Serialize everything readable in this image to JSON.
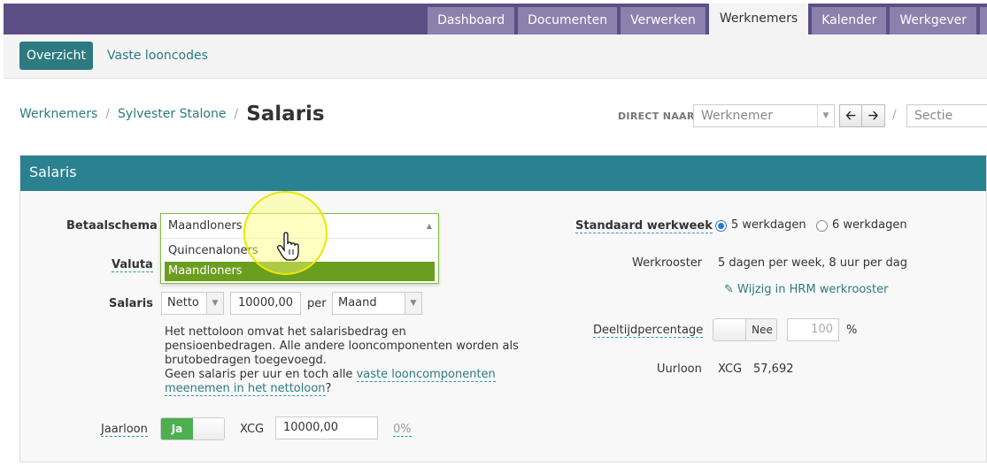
{
  "topnav": {
    "tabs": [
      "Dashboard",
      "Documenten",
      "Verwerken",
      "Werknemers",
      "Kalender",
      "Werkgever"
    ],
    "active": "Werknemers"
  },
  "subnav": {
    "primary": "Overzicht",
    "link": "Vaste looncodes"
  },
  "breadcrumb": {
    "item1": "Werknemers",
    "item2": "Sylvester Stalone",
    "sep": "/",
    "title": "Salaris"
  },
  "direct": {
    "label": "DIRECT NAAR",
    "werknemer_placeholder": "Werknemer",
    "sectie_placeholder": "Sectie",
    "slash": "/"
  },
  "panel": {
    "title": "Salaris"
  },
  "form": {
    "betaalschema_label": "Betaalschema",
    "betaalschema_value": "Maandloners",
    "betaalschema_options": [
      "Quincenaloners",
      "Maandloners"
    ],
    "valuta_label": "Valuta",
    "salaris_label": "Salaris",
    "salaris_type": "Netto",
    "salaris_amount": "10000,00",
    "per_label": "per",
    "period": "Maand",
    "help_text": "Het nettoloon omvat het salarisbedrag en pensioenbedragen. Alle andere looncomponenten worden als brutobedragen toegevoegd.",
    "help_q1": "Geen salaris per uur en toch alle ",
    "help_link": "vaste looncomponenten meenemen in het nettoloon",
    "help_q2": "?",
    "jaarloon_label": "Jaarloon",
    "jaarloon_toggle": "Ja",
    "jaarloon_currency": "XCG",
    "jaarloon_value": "10000,00",
    "jaarloon_pct": "0%"
  },
  "right": {
    "werkweek_label": "Standaard werkweek",
    "radio1": "5 werkdagen",
    "radio2": "6 werkdagen",
    "werkrooster_label": "Werkrooster",
    "werkrooster_value": "5 dagen per week, 8 uur per dag",
    "hrm_link": "Wijzig in HRM werkrooster",
    "deeltijd_label": "Deeltijdpercentage",
    "deeltijd_toggle": "Nee",
    "deeltijd_value": "100",
    "deeltijd_unit": "%",
    "uurloon_label": "Uurloon",
    "uurloon_currency": "XCG",
    "uurloon_value": "57,692"
  },
  "colors": {
    "nav": "#5b4f86",
    "tab": "#8a81ac",
    "accent": "#2d7a80",
    "panel_head": "#2a8190",
    "option_selected": "#6a9e1f"
  }
}
